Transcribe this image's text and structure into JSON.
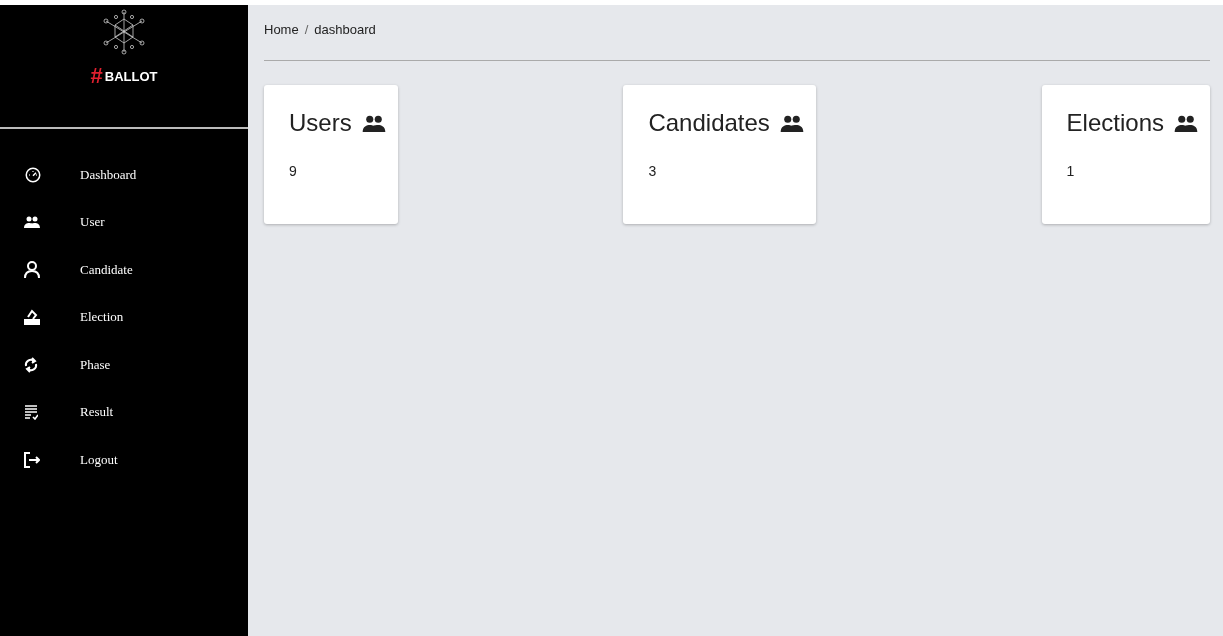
{
  "sidebar": {
    "logo": {
      "mark": "#",
      "text": "BALLOT"
    },
    "items": [
      {
        "label": "Dashboard",
        "kind": "gauge"
      },
      {
        "label": "User",
        "kind": "group"
      },
      {
        "label": "Candidate",
        "kind": "person"
      },
      {
        "label": "Election",
        "kind": "ballot"
      },
      {
        "label": "Phase",
        "kind": "sync"
      },
      {
        "label": "Result",
        "kind": "list"
      },
      {
        "label": "Logout",
        "kind": "logout"
      }
    ]
  },
  "breadcrumb": {
    "items": [
      "Home",
      "dashboard"
    ],
    "separator": "/"
  },
  "cards": [
    {
      "title": "Users",
      "value": "9"
    },
    {
      "title": "Candidates",
      "value": "3"
    },
    {
      "title": "Elections",
      "value": "1"
    }
  ]
}
